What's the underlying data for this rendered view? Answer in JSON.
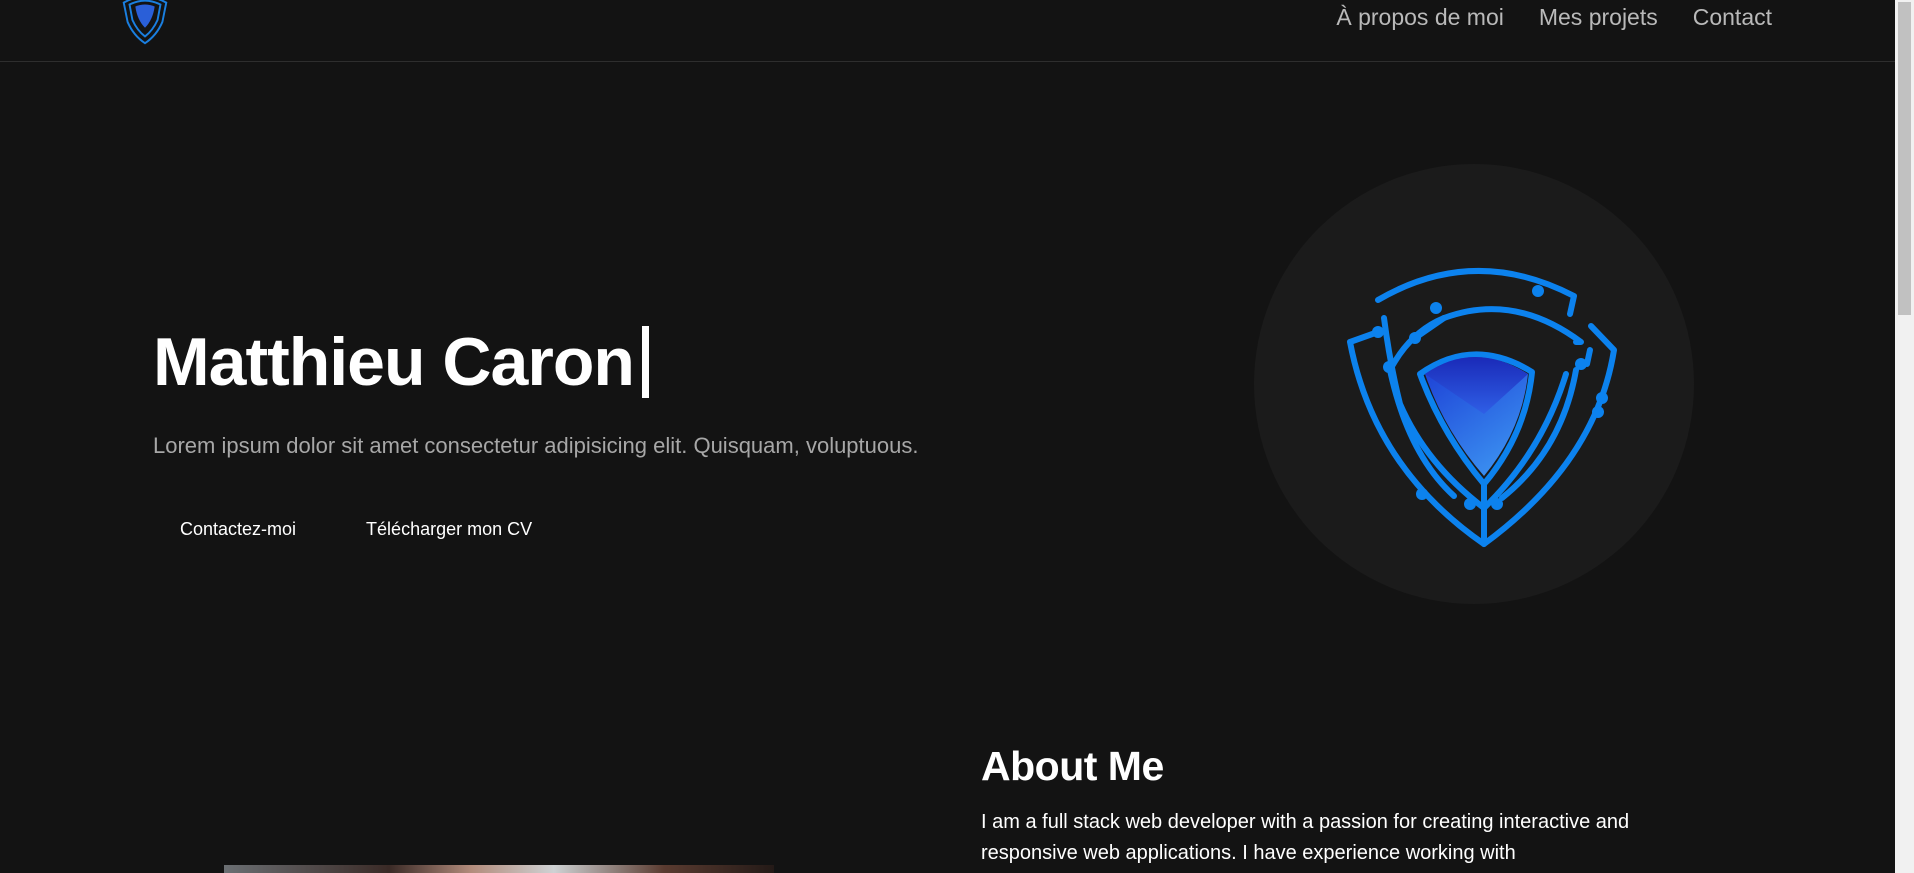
{
  "nav": {
    "logo_icon": "shield-logo-icon",
    "links": [
      {
        "label": "À propos de moi"
      },
      {
        "label": "Mes projets"
      },
      {
        "label": "Contact"
      }
    ]
  },
  "hero": {
    "title": "Matthieu Caron",
    "subtitle": "Lorem ipsum dolor sit amet consectetur adipisicing elit. Quisquam, voluptuous.",
    "buttons": {
      "contact": "Contactez-moi",
      "cv": "Télécharger mon CV"
    },
    "graphic_icon": "shield-circuit-icon"
  },
  "about": {
    "title": "About Me",
    "text": "I am a full stack web developer with a passion for creating interactive and responsive web applications. I have experience working with"
  },
  "colors": {
    "background": "#131313",
    "accent": "#0a84ed",
    "nav_text": "#b9b9b9"
  }
}
